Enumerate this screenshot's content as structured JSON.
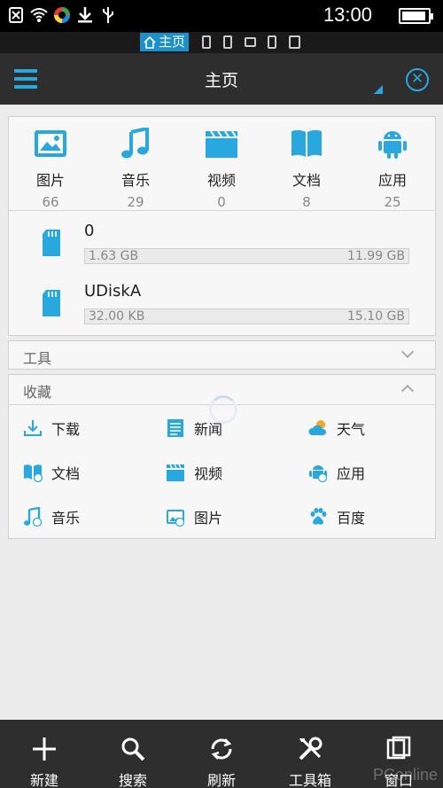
{
  "status_bar": {
    "time": "13:00",
    "battery_level": 0.8
  },
  "window_strip": {
    "active_tab": "主页"
  },
  "header": {
    "title": "主页"
  },
  "categories": [
    {
      "label": "图片",
      "count": "66",
      "icon": "image-icon"
    },
    {
      "label": "音乐",
      "count": "29",
      "icon": "music-icon"
    },
    {
      "label": "视频",
      "count": "0",
      "icon": "video-icon"
    },
    {
      "label": "文档",
      "count": "8",
      "icon": "book-icon"
    },
    {
      "label": "应用",
      "count": "25",
      "icon": "android-icon"
    }
  ],
  "storage": [
    {
      "name": "0",
      "used": "1.63 GB",
      "total": "11.99 GB"
    },
    {
      "name": "UDiskA",
      "used": "32.00 KB",
      "total": "15.10 GB"
    }
  ],
  "tools": {
    "title": "工具"
  },
  "favorites": {
    "title": "收藏",
    "items": [
      {
        "label": "下载",
        "icon": "download-icon"
      },
      {
        "label": "新闻",
        "icon": "news-icon"
      },
      {
        "label": "天气",
        "icon": "weather-icon"
      },
      {
        "label": "文档",
        "icon": "document-icon"
      },
      {
        "label": "视频",
        "icon": "video-icon"
      },
      {
        "label": "应用",
        "icon": "android-icon"
      },
      {
        "label": "音乐",
        "icon": "music-icon"
      },
      {
        "label": "图片",
        "icon": "image-icon"
      },
      {
        "label": "百度",
        "icon": "baidu-paw-icon"
      }
    ]
  },
  "bottom_bar": [
    {
      "label": "新建",
      "icon": "plus-icon"
    },
    {
      "label": "搜索",
      "icon": "search-icon"
    },
    {
      "label": "刷新",
      "icon": "refresh-icon"
    },
    {
      "label": "工具箱",
      "icon": "toolbox-icon"
    },
    {
      "label": "窗口",
      "icon": "window-icon"
    }
  ],
  "watermark": "PConline",
  "colors": {
    "accent": "#29a8e0",
    "bar_bg": "#2e2e2e",
    "page_bg": "#ececec"
  }
}
